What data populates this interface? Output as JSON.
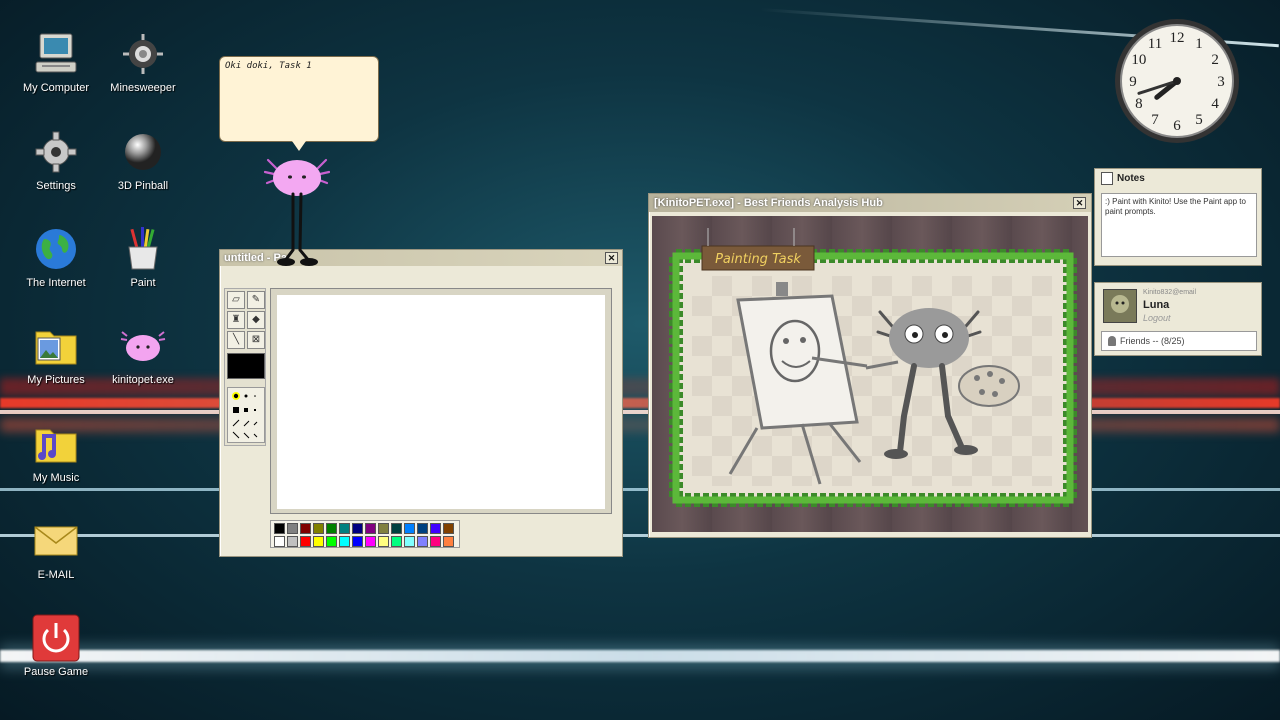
{
  "desktop": {
    "icons": [
      {
        "label": "My Computer"
      },
      {
        "label": "Minesweeper"
      },
      {
        "label": "Settings"
      },
      {
        "label": "3D Pinball"
      },
      {
        "label": "The Internet"
      },
      {
        "label": "Paint"
      },
      {
        "label": "My Pictures"
      },
      {
        "label": "kinitopet.exe"
      },
      {
        "label": "My Music"
      },
      {
        "label": "E-MAIL"
      },
      {
        "label": "Pause Game"
      }
    ]
  },
  "pet": {
    "speech": "Oki doki, Task 1"
  },
  "paint_window": {
    "title": "untitled - Pa",
    "close_glyph": "✕",
    "tool_icons": [
      "eraser-icon",
      "pencil-icon",
      "brush-icon",
      "fill-icon",
      "line-icon",
      "clear-icon"
    ],
    "current_color": "#000000",
    "palette_top": [
      "#000000",
      "#808080",
      "#800000",
      "#808000",
      "#008000",
      "#008080",
      "#000080",
      "#800080",
      "#808040",
      "#004040",
      "#0080ff",
      "#004080",
      "#4000ff",
      "#804000"
    ],
    "palette_bottom": [
      "#ffffff",
      "#c0c0c0",
      "#ff0000",
      "#ffff00",
      "#00ff00",
      "#00ffff",
      "#0000ff",
      "#ff00ff",
      "#ffff80",
      "#00ff80",
      "#80ffff",
      "#8080ff",
      "#ff0080",
      "#ff8040"
    ]
  },
  "kinito_window": {
    "title": "[KinitoPET.exe] - Best Friends Analysis Hub",
    "close_glyph": "✕",
    "task_sign": "Painting Task"
  },
  "notes_panel": {
    "title": "Notes",
    "text": ":) Paint with Kinito! Use the Paint app to paint prompts."
  },
  "user_panel": {
    "handle": "Kinito832@email",
    "name": "Luna",
    "logout": "Logout",
    "friends": "Friends -- (8/25)"
  },
  "clock": {
    "numbers": [
      "12",
      "1",
      "2",
      "3",
      "4",
      "5",
      "6",
      "7",
      "8",
      "9",
      "10",
      "11"
    ],
    "hour": 7,
    "minute": 42
  }
}
